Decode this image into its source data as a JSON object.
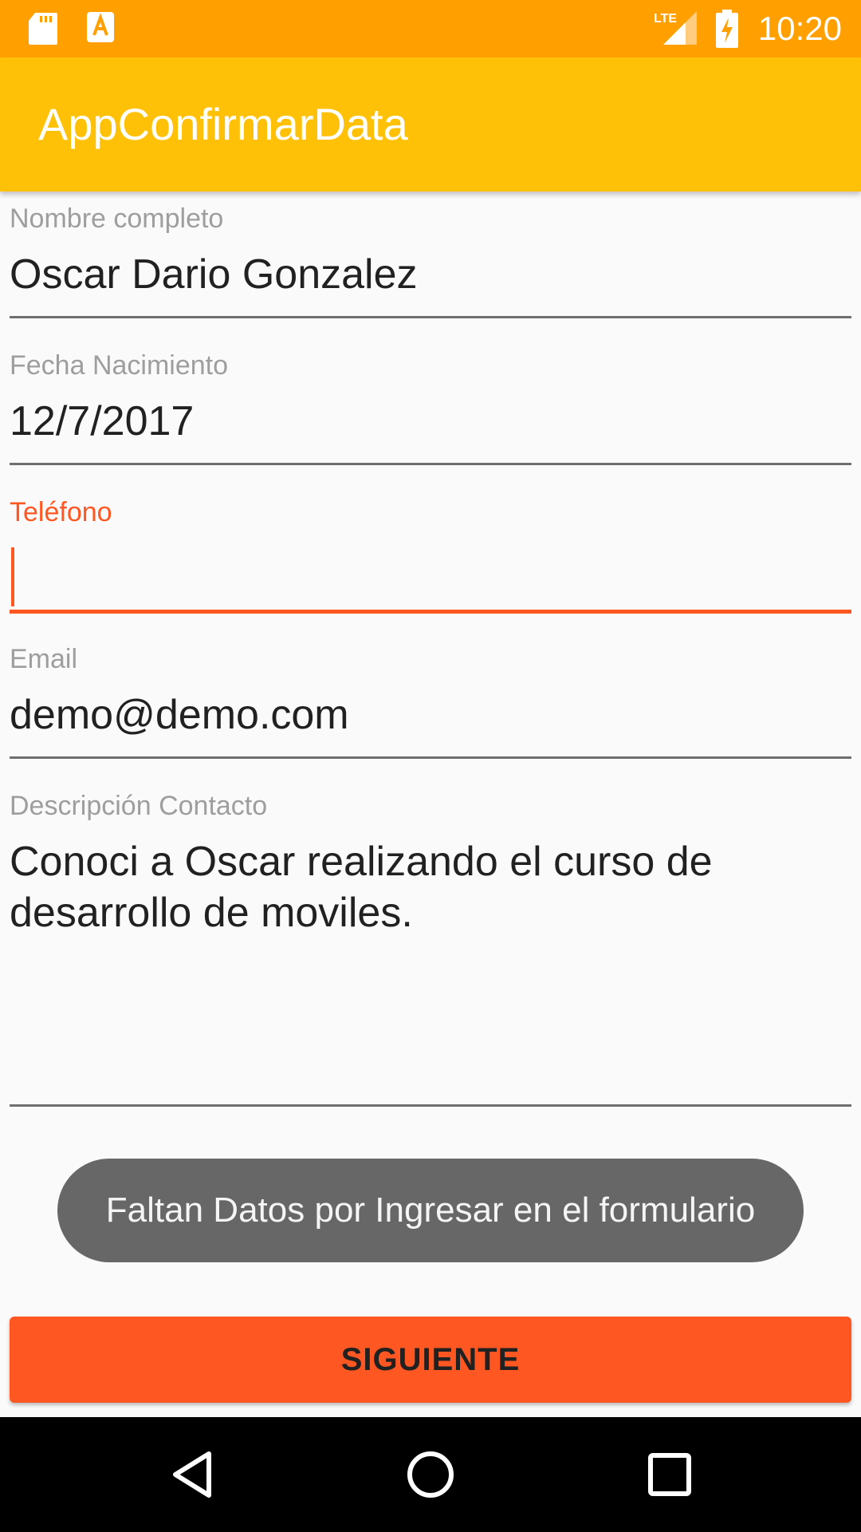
{
  "status_bar": {
    "time": "10:20",
    "icons": [
      "sd-card-icon",
      "app-notification-icon",
      "lte-signal-icon",
      "battery-charging-icon"
    ]
  },
  "app_bar": {
    "title": "AppConfirmarData"
  },
  "form": {
    "nombre": {
      "label": "Nombre completo",
      "value": "Oscar Dario Gonzalez"
    },
    "fecha": {
      "label": "Fecha Nacimiento",
      "value": "12/7/2017"
    },
    "telefono": {
      "label": "Teléfono",
      "value": ""
    },
    "email": {
      "label": "Email",
      "value": "demo@demo.com"
    },
    "descripcion": {
      "label": "Descripción Contacto",
      "value_line1": "Conoci a Oscar realizando el curso de",
      "value_line2": "desarrollo de moviles."
    }
  },
  "toast": {
    "message": "Faltan Datos por Ingresar en el formulario"
  },
  "next_button": {
    "label": "SIGUIENTE"
  },
  "nav_bar": {
    "icons": [
      "back-icon",
      "home-icon",
      "recents-icon"
    ]
  },
  "colors": {
    "status_bar": "#ffa000",
    "app_bar": "#ffc107",
    "accent": "#ff5722",
    "toast": "#676767"
  }
}
